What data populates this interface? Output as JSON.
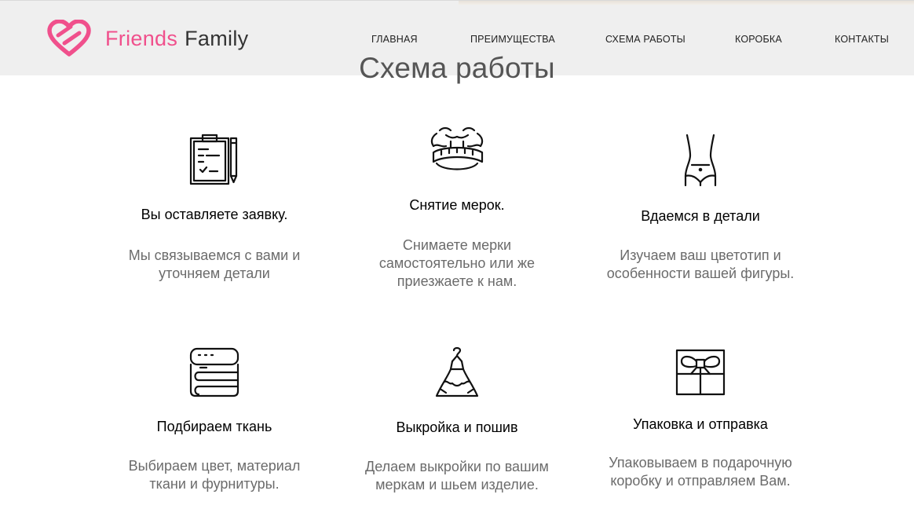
{
  "brand": {
    "word1": "Friends",
    "word2": "Family",
    "accent_color": "#f0508c",
    "icon": "heart-logo-icon"
  },
  "nav": {
    "items": [
      {
        "label": "ГЛАВНАЯ"
      },
      {
        "label": "ПРЕИМУЩЕСТВА"
      },
      {
        "label": "СХЕМА РАБОТЫ"
      },
      {
        "label": "КОРОБКА"
      },
      {
        "label": "КОНТАКТЫ"
      }
    ]
  },
  "section": {
    "title": "Схема работы"
  },
  "steps": [
    {
      "icon": "clipboard-icon",
      "title": "Вы оставляете заявку.",
      "desc_line1": "Мы связываемся с вами и",
      "desc_line2": "уточняем детали",
      "desc_line3": ""
    },
    {
      "icon": "measuring-tape-icon",
      "title": "Снятие мерок.",
      "desc_line1": "Снимаете мерки",
      "desc_line2": "самостоятельно или же",
      "desc_line3": "приезжаете к нам."
    },
    {
      "icon": "body-figure-icon",
      "title": "Вдаемся в детали",
      "desc_line1": "Изучаем ваш цветотип и",
      "desc_line2": "особенности вашей фигуры.",
      "desc_line3": ""
    },
    {
      "icon": "folded-fabric-icon",
      "title": "Подбираем ткань",
      "desc_line1": "Выбираем цвет, материал",
      "desc_line2": "ткани и фурнитуры.",
      "desc_line3": ""
    },
    {
      "icon": "dress-hanger-icon",
      "title": "Выкройка и пошив",
      "desc_line1": "Делаем выкройки по вашим",
      "desc_line2": "меркам и шьем изделие.",
      "desc_line3": ""
    },
    {
      "icon": "gift-box-icon",
      "title": "Упаковка и отправка",
      "desc_line1": "Упаковываем в подарочную",
      "desc_line2": "коробку и отправляем Вам.",
      "desc_line3": ""
    }
  ]
}
